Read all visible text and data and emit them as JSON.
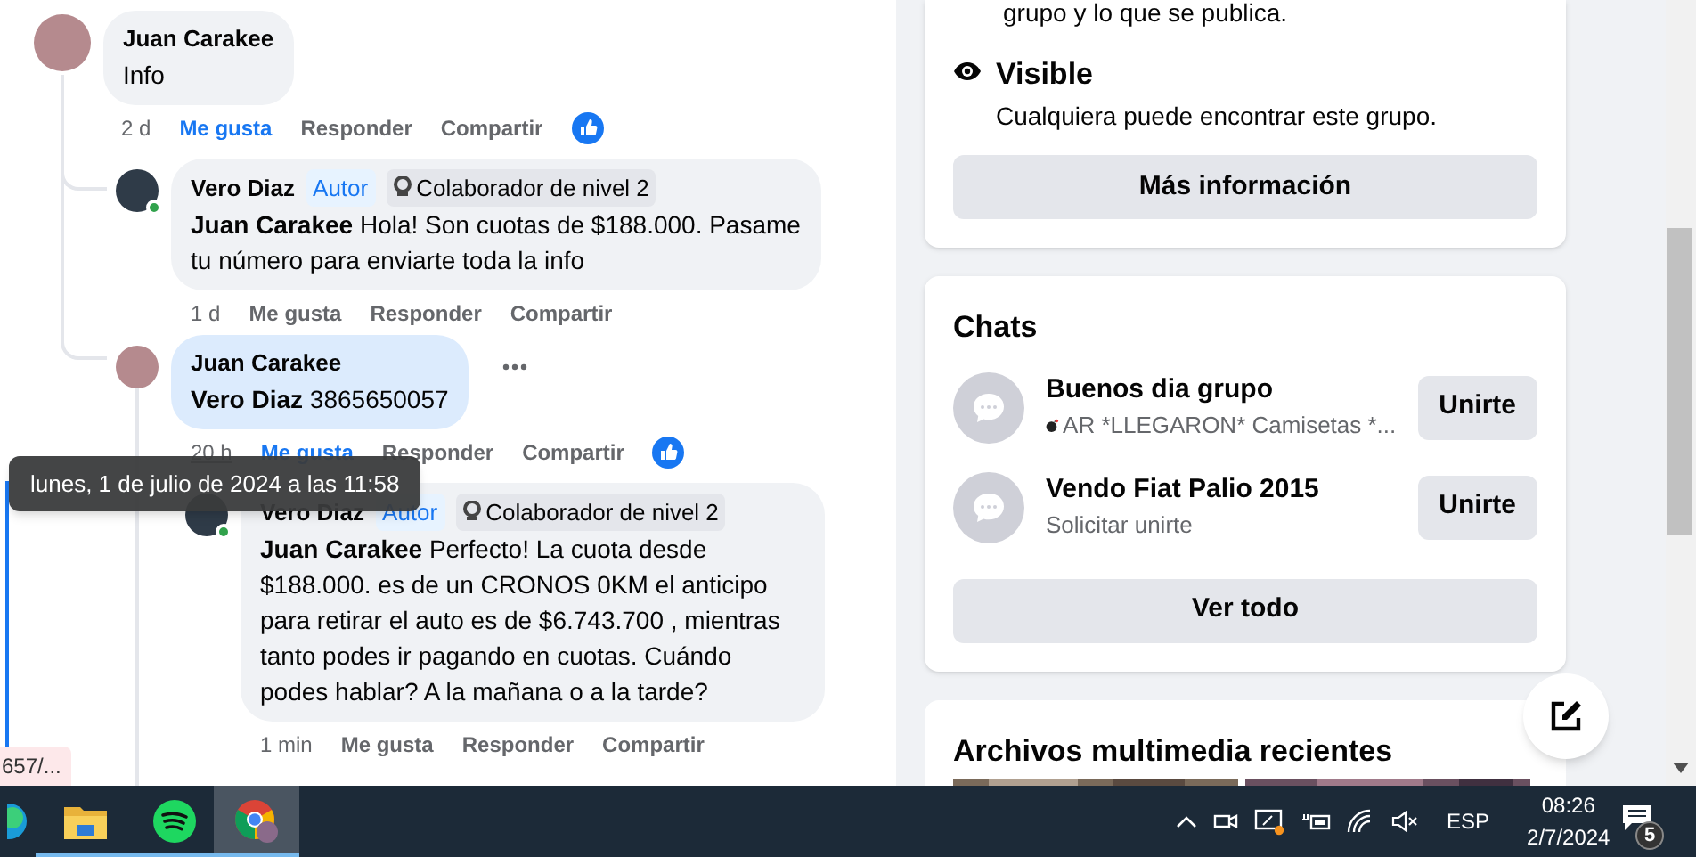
{
  "comments": [
    {
      "author": "Juan Carakee",
      "text": "Info",
      "time": "2 d",
      "liked": true,
      "reaction": true,
      "online": false,
      "selected": false,
      "options": false,
      "actions": [
        "Me gusta",
        "Responder",
        "Compartir"
      ],
      "children": [
        {
          "author": "Vero Diaz",
          "text": "**Juan Carakee** Hola! Son cuotas de $188.000. Pasame tu número para enviarte toda la info",
          "time": "1 d",
          "liked": false,
          "reaction": false,
          "online": true,
          "selected": false,
          "options": false,
          "badges": [
            {
              "kind": "role",
              "label": "Autor"
            },
            {
              "kind": "rank",
              "label": "Colaborador de nivel 2"
            }
          ],
          "actions": [
            "Me gusta",
            "Responder",
            "Compartir"
          ]
        },
        {
          "author": "Juan Carakee",
          "text": "**Vero Diaz** 3865650057",
          "time": "20 h",
          "liked": true,
          "reaction": true,
          "online": false,
          "selected": true,
          "options": true,
          "actions": [
            "Me gusta",
            "Responder",
            "Compartir"
          ],
          "children": [
            {
              "author": "Vero Diaz",
              "text": "**Juan Carakee** Perfecto! La cuota desde $188.000. es de un CRONOS 0KM el anticipo para retirar el auto es de $6.743.700 , mientras tanto podes ir pagando en cuotas. Cuándo podes hablar? A la mañana o a la tarde?",
              "time": "1 min",
              "liked": false,
              "reaction": false,
              "online": true,
              "selected": false,
              "options": false,
              "badges": [
                {
                  "kind": "role",
                  "label": "Autor"
                },
                {
                  "kind": "rank",
                  "label": "Colaborador de nivel 2"
                }
              ],
              "actions": [
                "Me gusta",
                "Responder",
                "Compartir"
              ]
            }
          ]
        }
      ]
    }
  ],
  "tooltip": "lunes, 1 de julio de 2024 a las 11:58",
  "status_url": "657/...",
  "about": {
    "cut_text": "grupo y lo que se publica.",
    "title": "Visible",
    "description": "Cualquiera puede encontrar este grupo.",
    "button": "Más información"
  },
  "chats": {
    "title": "Chats",
    "items": [
      {
        "name": "Buenos dia grupo",
        "subtitle": "AR *LLEGARON* Camisetas *...",
        "emoji": true,
        "join_button": "Unirte"
      },
      {
        "name": "Vendo Fiat Palio 2015",
        "subtitle": "Solicitar unirte",
        "emoji": false,
        "join_button": "Unirte"
      }
    ],
    "see_all": "Ver todo"
  },
  "media": {
    "title": "Archivos multimedia recientes"
  },
  "taskbar": {
    "apps": [
      {
        "kind": "edge",
        "selected": false
      },
      {
        "kind": "explorer",
        "selected": false
      },
      {
        "kind": "spotify",
        "selected": false
      },
      {
        "kind": "chrome",
        "selected": true
      }
    ],
    "language": "ESP",
    "time": "08:26",
    "date": "2/7/2024",
    "notifications": "5"
  }
}
